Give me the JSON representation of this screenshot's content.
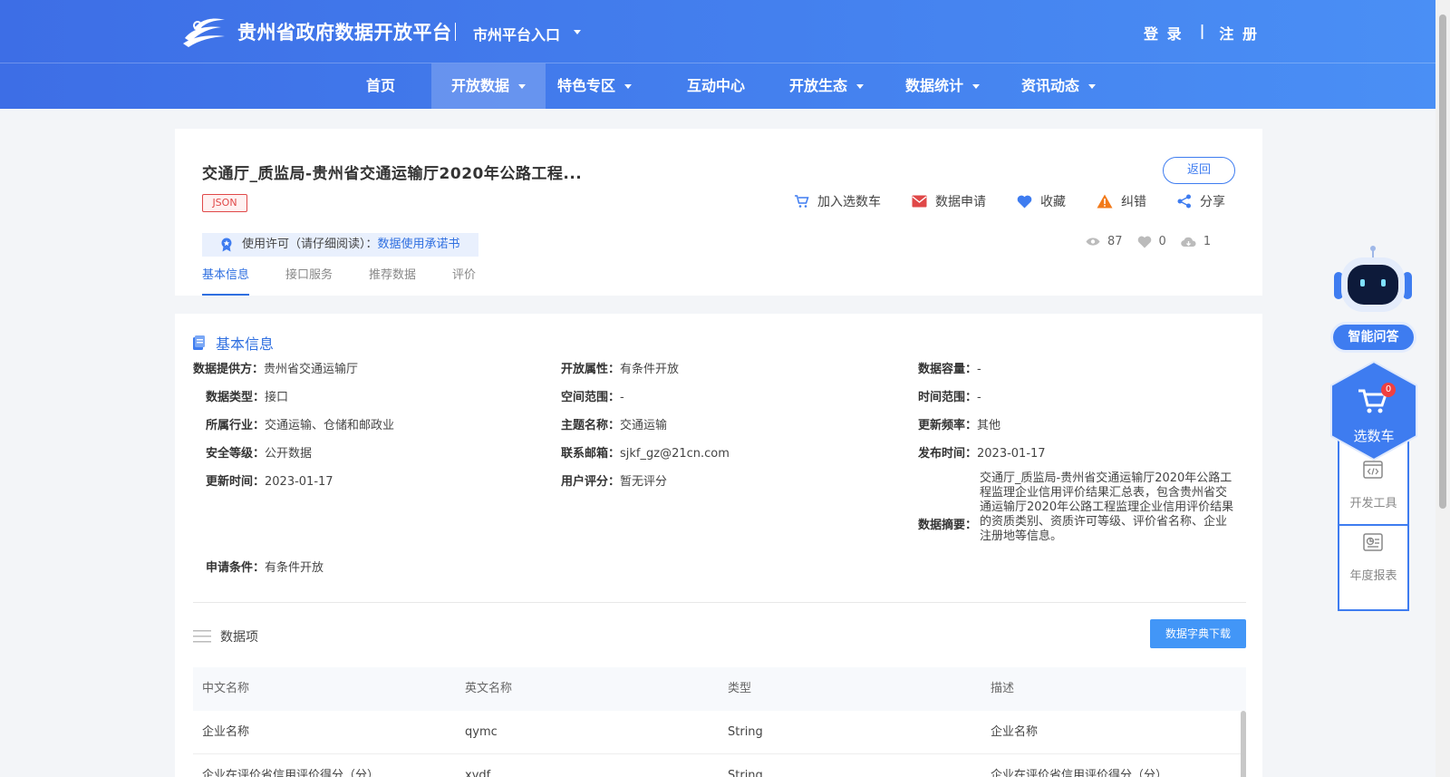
{
  "header": {
    "site_title": "贵州省政府数据开放平台",
    "city_entry": "市州平台入口",
    "login": "登 录",
    "auth_sep": "|",
    "register": "注 册"
  },
  "nav": [
    {
      "label": "首页",
      "dropdown": false,
      "active": false
    },
    {
      "label": "开放数据",
      "dropdown": true,
      "active": true
    },
    {
      "label": "特色专区",
      "dropdown": true,
      "active": false
    },
    {
      "label": "互动中心",
      "dropdown": false,
      "active": false
    },
    {
      "label": "开放生态",
      "dropdown": true,
      "active": false
    },
    {
      "label": "数据统计",
      "dropdown": true,
      "active": false
    },
    {
      "label": "资讯动态",
      "dropdown": true,
      "active": false
    }
  ],
  "dataset": {
    "title": "交通厅_质监局-贵州省交通运输厅2020年公路工程...",
    "format_tag": "JSON",
    "back_label": "返回",
    "actions": {
      "cart": "加入选数车",
      "apply": "数据申请",
      "favorite": "收藏",
      "report": "纠错",
      "share": "分享"
    },
    "license_label": "使用许可（请仔细阅读）：",
    "license_link": "数据使用承诺书",
    "stats": {
      "views": "87",
      "likes": "0",
      "downloads": "1"
    },
    "tabs": [
      "基本信息",
      "接口服务",
      "推荐数据",
      "评价"
    ]
  },
  "basic_info": {
    "section_title": "基本信息",
    "provider_k": "数据提供方：",
    "provider_v": "贵州省交通运输厅",
    "open_attr_k": "开放属性：",
    "open_attr_v": "有条件开放",
    "capacity_k": "数据容量：",
    "capacity_v": "-",
    "type_k": "数据类型：",
    "type_v": "接口",
    "space_k": "空间范围：",
    "space_v": "-",
    "time_k": "时间范围：",
    "time_v": "-",
    "industry_k": "所属行业：",
    "industry_v": "交通运输、仓储和邮政业",
    "theme_k": "主题名称：",
    "theme_v": "交通运输",
    "freq_k": "更新频率：",
    "freq_v": "其他",
    "security_k": "安全等级：",
    "security_v": "公开数据",
    "email_k": "联系邮箱：",
    "email_v": "sjkf_gz@21cn.com",
    "publish_k": "发布时间：",
    "publish_v": "2023-01-17",
    "update_k": "更新时间：",
    "update_v": "2023-01-17",
    "rating_k": "用户评分：",
    "rating_v": "暂无评分",
    "summary_k": "数据摘要：",
    "summary_v": "交通厅_质监局-贵州省交通运输厅2020年公路工程监理企业信用评价结果汇总表，包含贵州省交通运输厅2020年公路工程监理企业信用评价结果的资质类别、资质许可等级、评价省名称、企业注册地等信息。",
    "condition_k": "申请条件：",
    "condition_v": "有条件开放"
  },
  "data_items": {
    "title": "数据项",
    "download_label": "数据字典下载",
    "columns": [
      "中文名称",
      "英文名称",
      "类型",
      "描述"
    ],
    "rows": [
      [
        "企业名称",
        "qymc",
        "String",
        "企业名称"
      ],
      [
        "企业在评价省信用评价得分（分）",
        "xydf",
        "String",
        "企业在评价省信用评价得分（分）"
      ]
    ]
  },
  "float": {
    "ask": "智能问答",
    "cart": "选数车",
    "cart_count": "0",
    "dev_tools": "开发工具",
    "annual_report": "年度报表"
  },
  "colors": {
    "primary": "#3e7cf0",
    "header_start": "#3d6ee6",
    "header_end": "#4a8ff5",
    "danger": "#e04848"
  }
}
